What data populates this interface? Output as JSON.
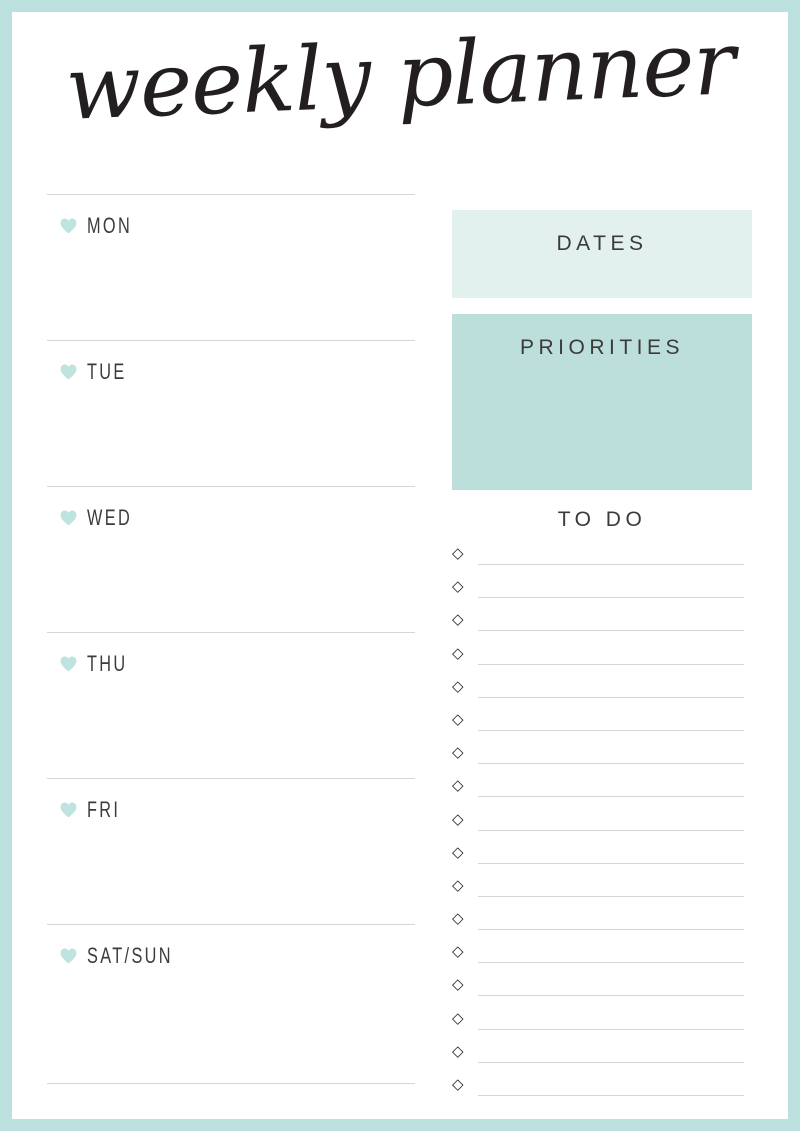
{
  "page": {
    "title": "weekly planner",
    "border_color": "#bce0dd",
    "sheet_color": "#ffffff",
    "rule_color": "#d7d7d7",
    "text_color": "#3b3b3b"
  },
  "days": {
    "heart_icon": "heart-icon",
    "heart_color": "#bfe3de",
    "items": [
      {
        "label": "MON"
      },
      {
        "label": "TUE"
      },
      {
        "label": "WED"
      },
      {
        "label": "THU"
      },
      {
        "label": "FRI"
      },
      {
        "label": "SAT/SUN"
      }
    ]
  },
  "panels": {
    "dates": {
      "title": "DATES",
      "background": "#e2f0ee"
    },
    "priorities": {
      "title": "PRIORITIES",
      "background": "#bcdfdb"
    }
  },
  "todo": {
    "title": "TO DO",
    "bullet_icon": "diamond-icon",
    "bullet_glyph": "◇",
    "row_count": 17,
    "rows": [
      {
        "value": ""
      },
      {
        "value": ""
      },
      {
        "value": ""
      },
      {
        "value": ""
      },
      {
        "value": ""
      },
      {
        "value": ""
      },
      {
        "value": ""
      },
      {
        "value": ""
      },
      {
        "value": ""
      },
      {
        "value": ""
      },
      {
        "value": ""
      },
      {
        "value": ""
      },
      {
        "value": ""
      },
      {
        "value": ""
      },
      {
        "value": ""
      },
      {
        "value": ""
      },
      {
        "value": ""
      }
    ]
  }
}
